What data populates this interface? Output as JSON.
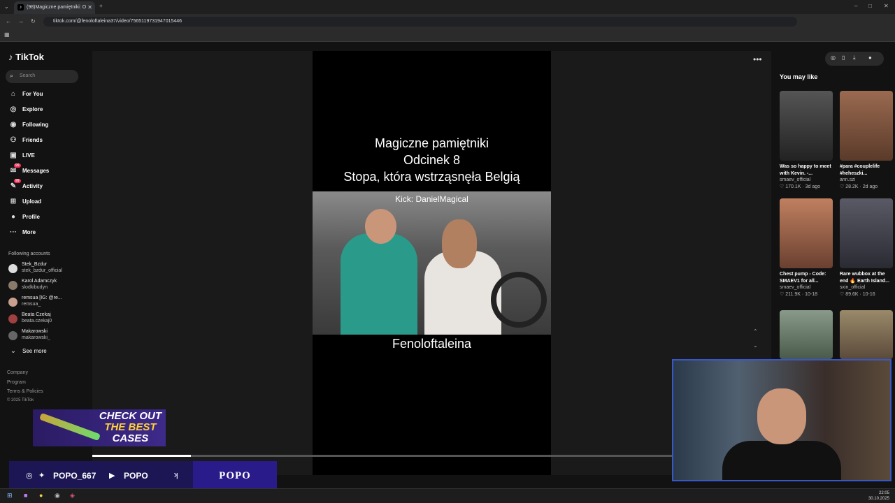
{
  "browser": {
    "tab_title": "(98)Magiczne pamiętniki: O",
    "url": "tiktok.com/@fenoloftaleina37/video/7565119731947015446"
  },
  "sidebar": {
    "logo": "TikTok",
    "search_placeholder": "Search",
    "nav": [
      {
        "label": "For You",
        "icon": "home-icon"
      },
      {
        "label": "Explore",
        "icon": "compass-icon"
      },
      {
        "label": "Following",
        "icon": "following-icon"
      },
      {
        "label": "Friends",
        "icon": "friends-icon"
      },
      {
        "label": "LIVE",
        "icon": "live-icon"
      },
      {
        "label": "Messages",
        "icon": "messages-icon",
        "badge": "99"
      },
      {
        "label": "Activity",
        "icon": "activity-icon",
        "badge": "99"
      },
      {
        "label": "Upload",
        "icon": "upload-icon"
      },
      {
        "label": "Profile",
        "icon": "profile-icon"
      },
      {
        "label": "More",
        "icon": "more-icon"
      }
    ],
    "following_title": "Following accounts",
    "accounts": [
      {
        "name": "Stek_Bzdur",
        "handle": "stek_bzdur_official"
      },
      {
        "name": "Karol Adamczyk",
        "handle": "slodkibudyn"
      },
      {
        "name": "remsua [IG: @re...",
        "handle": "remsua_"
      },
      {
        "name": "Beata Czekaj",
        "handle": "beata.czekaj0"
      },
      {
        "name": "Makarowski",
        "handle": "makarowski_"
      }
    ],
    "see_more": "See more",
    "footer": [
      "Company",
      "Program",
      "Terms & Policies",
      "© 2025 TikTok"
    ]
  },
  "video": {
    "title_lines": [
      "Magiczne pamiętniki",
      "Odcinek 8",
      "Stopa, która wstrząsnęła Belgią"
    ],
    "kick_label": "Kick: DanielMagical",
    "creator_caption": "Fenoloftaleina",
    "progress_fraction": 0.17
  },
  "right_panel": {
    "heading": "You may like",
    "cards": [
      {
        "title": "Was so happy to meet with Kevin. -...",
        "user": "smaev_official",
        "likes": "170.1K",
        "date": "3d ago",
        "color": "#3b3b3b"
      },
      {
        "title": "#para #couplelife #heheszki...",
        "user": "ann.szi",
        "likes": "28.2K",
        "date": "2d ago",
        "color": "#8a5a40"
      },
      {
        "title": "Chest pump - Code: SMAEV1 for all...",
        "user": "smaev_official",
        "likes": "211.9K",
        "date": "10-18",
        "color": "#9a6040"
      },
      {
        "title": "Rare wubbox at the end 🔥 Earth Island...",
        "user": "sxin_official",
        "likes": "89.6K",
        "date": "10-16",
        "color": "#4a4a55"
      },
      {
        "title": "",
        "user": "",
        "likes": "",
        "date": "",
        "color": "#6a7a6a"
      },
      {
        "title": "",
        "user": "",
        "likes": "",
        "date": "",
        "color": "#7a6a55"
      }
    ]
  },
  "overlays": {
    "banner_line1": "CHECK OUT",
    "banner_line2": "THE BEST",
    "banner_line3": "CASES",
    "twitter_handle": "POPO_667",
    "youtube_handle": "POPO",
    "brand": "POPO"
  },
  "taskbar": {
    "time": "22:05",
    "date": "30.10.2025"
  }
}
